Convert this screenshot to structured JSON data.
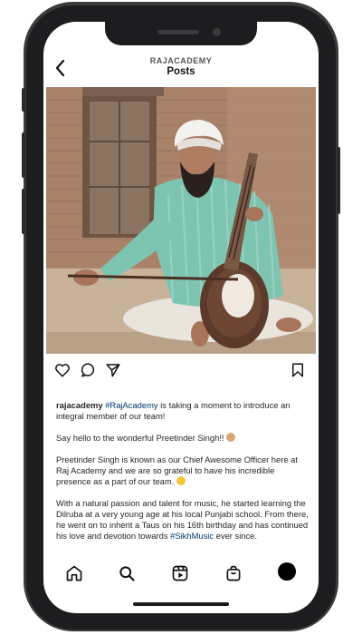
{
  "header": {
    "username": "RAJACADEMY",
    "title": "Posts"
  },
  "post": {
    "image_alt": "Man in turban playing a Dilruba",
    "caption": {
      "username": "rajacademy",
      "hashtag1": "#RajAcademy",
      "p1_rest": " is taking a moment to introduce an integral member of our team!",
      "p2": "Say hello to the wonderful Preetinder Singh!! ",
      "p3": "Preetinder Singh is known as our Chief Awesome Officer here at Raj Academy and we are so grateful to have his incredible presence as a part of our team. ",
      "p4_start": "With a natural passion and talent for music, he started learning the Dilruba at a very young age at his local Punjabi school. From there, he went on to inherit a Taus on his 16th birthday and has continued his love and devotion towards ",
      "hashtag2": "#SikhMusic",
      "p4_end": " ever since."
    }
  },
  "icons": {
    "back": "chevron-left-icon",
    "like": "heart-icon",
    "comment": "comment-icon",
    "share": "send-icon",
    "save": "bookmark-icon",
    "home": "home-icon",
    "search": "search-icon",
    "reels": "reels-icon",
    "shop": "shop-bag-icon",
    "profile": "profile-avatar-icon"
  },
  "colors": {
    "hashtag": "#00376b",
    "text": "#262626"
  }
}
